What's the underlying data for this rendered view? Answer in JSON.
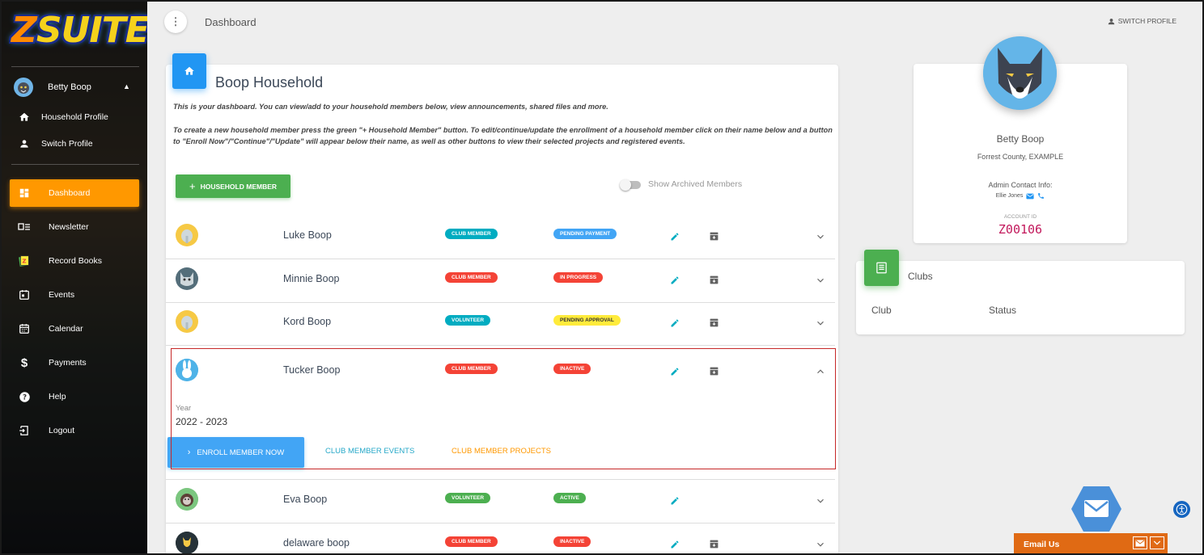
{
  "app": {
    "logo": "ZSUITE"
  },
  "sidebar": {
    "user_name": "Betty Boop",
    "user_links": [
      {
        "label": "Household Profile",
        "icon": "home-icon"
      },
      {
        "label": "Switch Profile",
        "icon": "person-icon"
      }
    ],
    "items": [
      {
        "label": "Dashboard",
        "icon": "dashboard-icon",
        "active": true
      },
      {
        "label": "Newsletter",
        "icon": "newsletter-icon"
      },
      {
        "label": "Record Books",
        "icon": "record-books-icon"
      },
      {
        "label": "Events",
        "icon": "events-icon"
      },
      {
        "label": "Calendar",
        "icon": "calendar-icon"
      },
      {
        "label": "Payments",
        "icon": "dollar-icon"
      },
      {
        "label": "Help",
        "icon": "help-icon"
      },
      {
        "label": "Logout",
        "icon": "logout-icon"
      }
    ]
  },
  "topbar": {
    "breadcrumb": "Dashboard",
    "switch_profile": "SWITCH PROFILE"
  },
  "household": {
    "title": "Boop Household",
    "intro1": "This is your dashboard. You can view/add to your household members below, view announcements, shared files and more.",
    "intro2": "To create a new household member press the green \"+ Household Member\" button. To edit/continue/update the enrollment of a household member click on their name below and a button to \"Enroll Now\"/\"Continue\"/\"Update\" will appear below their name, as well as other buttons to view their selected projects and registered events.",
    "add_button": "HOUSEHOLD MEMBER",
    "toggle_label": "Show Archived Members",
    "members": [
      {
        "name": "Luke Boop",
        "role": "CLUB MEMBER",
        "role_color": "#00acc1",
        "status": "PENDING PAYMENT",
        "status_color": "#42a5f5",
        "status_text_color": "#ffffff",
        "archive": true,
        "expanded": false
      },
      {
        "name": "Minnie Boop",
        "role": "CLUB MEMBER",
        "role_color": "#f44336",
        "status": "IN PROGRESS",
        "status_color": "#f44336",
        "status_text_color": "#ffffff",
        "archive": true,
        "expanded": false
      },
      {
        "name": "Kord Boop",
        "role": "VOLUNTEER",
        "role_color": "#00acc1",
        "status": "PENDING APPROVAL",
        "status_color": "#ffeb3b",
        "status_text_color": "#333333",
        "archive": true,
        "expanded": false
      },
      {
        "name": "Tucker Boop",
        "role": "CLUB MEMBER",
        "role_color": "#f44336",
        "status": "INACTIVE",
        "status_color": "#f44336",
        "status_text_color": "#ffffff",
        "archive": true,
        "expanded": true
      },
      {
        "name": "Eva Boop",
        "role": "VOLUNTEER",
        "role_color": "#4caf50",
        "status": "ACTIVE",
        "status_color": "#4caf50",
        "status_text_color": "#ffffff",
        "archive": false,
        "expanded": false
      },
      {
        "name": "delaware boop",
        "role": "CLUB MEMBER",
        "role_color": "#f44336",
        "status": "INACTIVE",
        "status_color": "#f44336",
        "status_text_color": "#ffffff",
        "archive": true,
        "expanded": false
      }
    ],
    "expanded": {
      "year_label": "Year",
      "year_value": "2022 - 2023",
      "enroll_button": "ENROLL MEMBER NOW",
      "events_link": "CLUB MEMBER EVENTS",
      "projects_link": "CLUB MEMBER PROJECTS"
    }
  },
  "profile": {
    "name": "Betty Boop",
    "county": "Forrest County, EXAMPLE",
    "admin_label": "Admin Contact Info:",
    "admin_name": "Ellie Jones",
    "account_id_label": "ACCOUNT ID",
    "account_id": "Z00106"
  },
  "clubs": {
    "title": "Clubs",
    "col_club": "Club",
    "col_status": "Status"
  },
  "footer": {
    "email_us": "Email Us"
  },
  "colors": {
    "accent_orange": "#ff9800",
    "primary_blue": "#2196f3",
    "green": "#4caf50",
    "account_id": "#c2185b"
  }
}
